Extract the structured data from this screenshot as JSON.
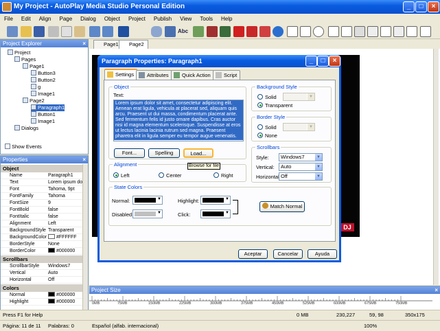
{
  "window": {
    "title": "My Project - AutoPlay Media Studio Personal Edition"
  },
  "menu": [
    "File",
    "Edit",
    "Align",
    "Page",
    "Dialog",
    "Object",
    "Project",
    "Publish",
    "View",
    "Tools",
    "Help"
  ],
  "project_explorer": {
    "title": "Project Explorer",
    "tree": [
      {
        "label": "Project",
        "level": 0
      },
      {
        "label": "Pages",
        "level": 1
      },
      {
        "label": "Page1",
        "level": 2
      },
      {
        "label": "Button3",
        "level": 3
      },
      {
        "label": "Button2",
        "level": 3
      },
      {
        "label": "g",
        "level": 3
      },
      {
        "label": "Image1",
        "level": 3
      },
      {
        "label": "Page2",
        "level": 2
      },
      {
        "label": "Paragraph1",
        "level": 3
      },
      {
        "label": "Button1",
        "level": 3
      },
      {
        "label": "Image1",
        "level": 3
      },
      {
        "label": "Dialogs",
        "level": 1
      }
    ],
    "show_events": "Show Events"
  },
  "properties": {
    "title": "Properties",
    "sections": [
      {
        "name": "Object",
        "rows": [
          [
            "Name",
            "Paragraph1"
          ],
          [
            "Text",
            "Lorem ipsum dol"
          ],
          [
            "Font",
            "Tahoma, 9pt"
          ],
          [
            "FontFamily",
            "Tahoma"
          ],
          [
            "FontSize",
            "9"
          ],
          [
            "FontBold",
            "false"
          ],
          [
            "FontItalic",
            "false"
          ],
          [
            "Alignment",
            "Left"
          ],
          [
            "BackgroundStyle",
            "Transparent"
          ],
          [
            "BackgroundColor",
            "#FFFFFF"
          ],
          [
            "BorderStyle",
            "None"
          ],
          [
            "BorderColor",
            "#000000"
          ]
        ]
      },
      {
        "name": "Scrollbars",
        "rows": [
          [
            "ScrollbarStyle",
            "Windows7"
          ],
          [
            "Vertical",
            "Auto"
          ],
          [
            "Horizontal",
            "Off"
          ]
        ]
      },
      {
        "name": "Colors",
        "rows": [
          [
            "Normal",
            "#000000"
          ],
          [
            "Highlight",
            "#000000"
          ]
        ]
      }
    ]
  },
  "page_tabs": [
    "Page1",
    "Page2"
  ],
  "dialog": {
    "title": "Paragraph Properties: Paragraph1",
    "tabs": [
      "Settings",
      "Attributes",
      "Quick Action",
      "Script"
    ],
    "object_group": "Object",
    "text_label": "Text:",
    "text_value": "Lorem ipsum dolor sit amet, consectetur adipiscing elit. Aenean erat ligula, vehicula at placerat sed, aliquam quis arcu. Praesent ut dui massa, condimentum placerat ante. Sed fermentum felis id justo ornare dapibus. Cras auctor nisi id magna elementum scelerisque. Suspendisse at eros ut lectus lacinia lacinia rutrum sed magna. Praesent pharetra elit in ligula semper eu tempor augue venenatis.",
    "font_btn": "Font...",
    "spelling_btn": "Spelling",
    "load_btn": "Load...",
    "tooltip": "Browse for file",
    "alignment_group": "Alignment",
    "align_left": "Left",
    "align_center": "Center",
    "align_right": "Right",
    "bg_group": "Background Style",
    "bg_solid": "Solid",
    "bg_transparent": "Transparent",
    "border_group": "Border Style",
    "border_solid": "Solid",
    "border_none": "None",
    "scroll_group": "Scrollbars",
    "style_label": "Style:",
    "style_value": "Windows7",
    "vertical_label": "Vertical:",
    "vertical_value": "Auto",
    "horizontal_label": "Horizontal:",
    "horizontal_value": "Off",
    "state_group": "State Colors",
    "normal_label": "Normal:",
    "disabled_label": "Disabled:",
    "highlight_label": "Highlight:",
    "click_label": "Click:",
    "match_btn": "Match Normal",
    "ok": "Aceptar",
    "cancel": "Cancelar",
    "help": "Ayuda"
  },
  "project_size": {
    "title": "Project Size",
    "marks": [
      "0MB",
      "75MB",
      "150MB",
      "225MB",
      "300MB",
      "375MB",
      "450MB",
      "525MB",
      "600MB",
      "675MB",
      "750MB"
    ]
  },
  "status": {
    "help": "Press F1 for Help",
    "size": "0 MB",
    "pos": "230,227",
    "dims": "59, 98",
    "wh": "350x175"
  },
  "word_status": {
    "page": "Página: 11 de 11",
    "words": "Palabras: 0",
    "lang": "Español (alfab. internacional)",
    "zoom": "100%"
  }
}
